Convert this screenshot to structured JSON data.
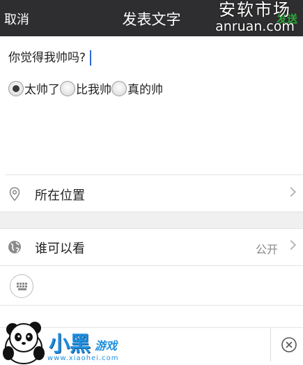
{
  "header": {
    "cancel": "取消",
    "title": "发表文字",
    "send": "发送"
  },
  "watermark_top": {
    "line1": "安软市场",
    "line2": "anruan.com"
  },
  "compose": {
    "text": "你觉得我帅吗?"
  },
  "poll": {
    "options": [
      {
        "label": "太帅了",
        "selected": true
      },
      {
        "label": "比我帅",
        "selected": false
      },
      {
        "label": "真的帅",
        "selected": false
      }
    ]
  },
  "location": {
    "label": "所在位置",
    "icon": "location-pin-icon"
  },
  "visibility": {
    "label": "谁可以看",
    "value": "公开",
    "icon": "globe-icon"
  },
  "toolbar": {
    "keyboard_icon": "keyboard-icon",
    "close_icon": "close-circle-icon"
  },
  "watermark_bottom": {
    "logo_text": "小黑",
    "logo_sub": "游戏",
    "url": "www.xiaohei.com"
  },
  "colors": {
    "header_bg": "#2e2e30",
    "send": "#29a834",
    "caret": "#2b6ad6",
    "logo_blue": "#1f8fe0"
  }
}
